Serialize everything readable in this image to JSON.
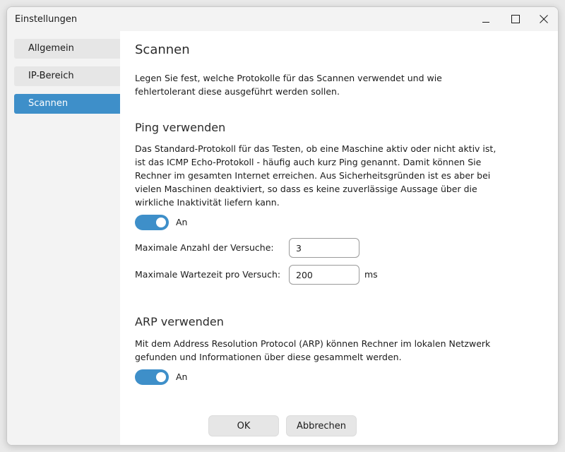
{
  "window": {
    "title": "Einstellungen",
    "controls": {
      "minimize_icon": "minimize-icon",
      "maximize_icon": "maximize-icon",
      "close_icon": "close-icon"
    }
  },
  "sidebar": {
    "items": [
      {
        "label": "Allgemein",
        "active": false
      },
      {
        "label": "IP-Bereich",
        "active": false
      },
      {
        "label": "Scannen",
        "active": true
      }
    ]
  },
  "main": {
    "heading": "Scannen",
    "intro": "Legen Sie fest, welche Protokolle für das Scannen verwendet und wie fehlertolerant diese ausgeführt werden sollen.",
    "ping": {
      "heading": "Ping verwenden",
      "description": "Das Standard-Protokoll für das Testen, ob eine Maschine aktiv oder nicht aktiv ist, ist das ICMP Echo-Protokoll - häufig auch kurz Ping genannt. Damit können Sie Rechner im gesamten Internet erreichen. Aus Sicherheitsgründen ist es aber bei vielen Maschinen deaktiviert, so dass es keine zuverlässige Aussage über die wirkliche Inaktivität liefern kann.",
      "toggle_label": "An",
      "toggle_on": true,
      "attempts_label": "Maximale Anzahl der Versuche:",
      "attempts_value": "3",
      "timeout_label": "Maximale Wartezeit pro Versuch:",
      "timeout_value": "200",
      "timeout_unit": "ms"
    },
    "arp": {
      "heading": "ARP verwenden",
      "description": "Mit dem Address Resolution Protocol (ARP) können Rechner im lokalen Netzwerk gefunden und Informationen über diese gesammelt werden.",
      "toggle_label": "An",
      "toggle_on": true
    }
  },
  "footer": {
    "ok_label": "OK",
    "cancel_label": "Abbrechen"
  },
  "colors": {
    "accent": "#3e8fc9",
    "sidebar_bg": "#f3f3f3",
    "button_bg": "#e6e6e6"
  }
}
